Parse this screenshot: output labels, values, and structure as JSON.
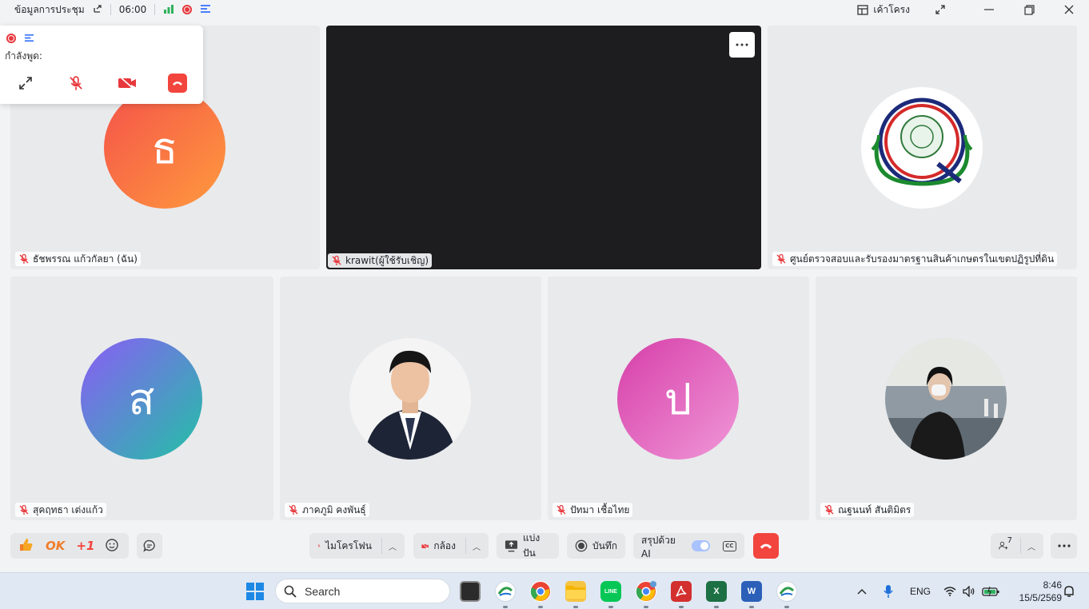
{
  "titlebar": {
    "meeting_info": "ข้อมูลการประชุม",
    "timer": "06:00",
    "layout_label": "เค้าโครง"
  },
  "mini_panel": {
    "speaking_label": "กำลังพูด:"
  },
  "tiles": [
    {
      "name": "ธัชพรรณ แก้วกัลยา (ฉัน)",
      "initial": "ธ",
      "color_from": "#f4524a",
      "color_to": "#ff9a3d"
    },
    {
      "name": "krawit(ผู้ใช้รับเชิญ)"
    },
    {
      "name": "ศูนย์ตรวจสอบและรับรองมาตรฐานสินค้าเกษตรในเขตปฏิรูปที่ดิน"
    },
    {
      "name": "สุคฤทธา เต่งแก้ว",
      "initial": "ส",
      "color_from": "#8b5cf6",
      "color_to": "#22c1a5"
    },
    {
      "name": "ภาคภูมิ คงพันธุ์"
    },
    {
      "name": "ปัทมา เชื้อไทย",
      "initial": "ป",
      "color_from": "#d63ea8",
      "color_to": "#f098d8"
    },
    {
      "name": "ณฐนนท์ สันติมิตร"
    }
  ],
  "reactions": {
    "ok": "OK",
    "plus_one": "+1"
  },
  "controls": {
    "mic_label": "ไมโครโฟน",
    "camera_label": "กล้อง",
    "share_label": "แบ่งปัน",
    "record_label": "บันทึก",
    "ai_summary_label": "สรุปด้วย AI",
    "cc_label": "CC",
    "participants_count": "7"
  },
  "taskbar": {
    "search_placeholder": "Search",
    "lang": "ENG",
    "time": "8:46",
    "date": "15/5/2569"
  },
  "colors": {
    "accent_red": "#f2453d",
    "accent_blue": "#3370ff",
    "tile_bg": "#e9eaec"
  }
}
